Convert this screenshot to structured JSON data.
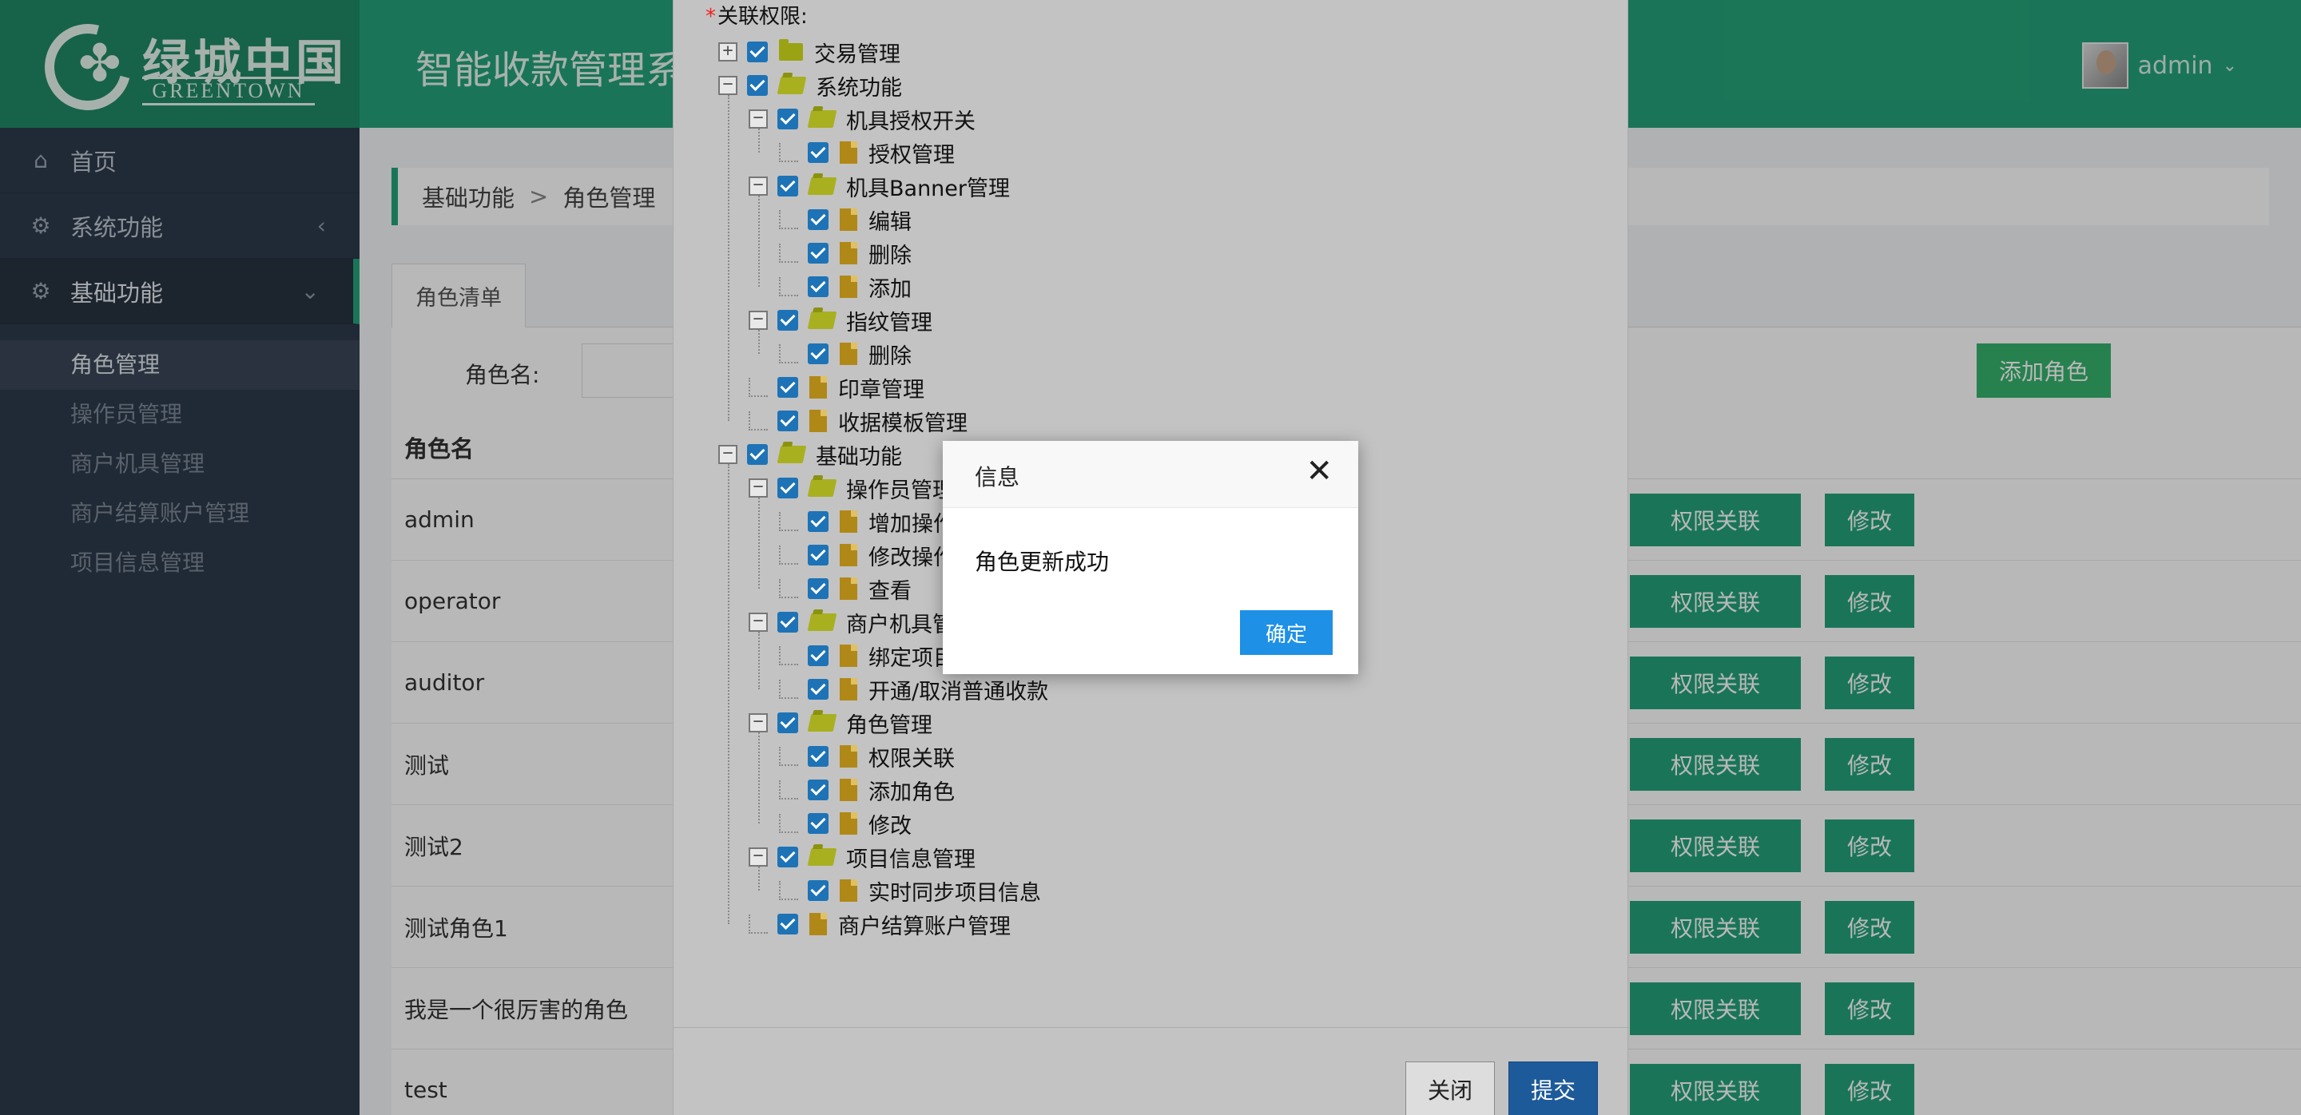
{
  "header": {
    "logo_cn": "绿城中国",
    "logo_en": "GREENTOWN",
    "app_title": "智能收款管理系",
    "user_name": "admin"
  },
  "sidebar": {
    "items": [
      {
        "label": "首页",
        "icon": "home-icon"
      },
      {
        "label": "系统功能",
        "icon": "gears-icon"
      },
      {
        "label": "基础功能",
        "icon": "gears-icon"
      }
    ],
    "sub_items": [
      {
        "label": "角色管理"
      },
      {
        "label": "操作员管理"
      },
      {
        "label": "商户机具管理"
      },
      {
        "label": "商户结算账户管理"
      },
      {
        "label": "项目信息管理"
      }
    ]
  },
  "main": {
    "breadcrumb": {
      "parent": "基础功能",
      "separator": ">",
      "current": "角色管理"
    },
    "tab_label": "角色清单",
    "search_label": "角色名:",
    "add_role_label": "添加角色",
    "table": {
      "header": "角色名",
      "rows": [
        {
          "name": "admin"
        },
        {
          "name": "operator"
        },
        {
          "name": "auditor"
        },
        {
          "name": "测试"
        },
        {
          "name": "测试2"
        },
        {
          "name": "测试角色1"
        },
        {
          "name": "我是一个很厉害的角色"
        },
        {
          "name": "test"
        }
      ],
      "perm_btn_label": "权限关联",
      "edit_btn_label": "修改"
    }
  },
  "perm_layer": {
    "label_required": "*",
    "label": "关联权限:",
    "tree": [
      {
        "depth": 0,
        "toggle": "+",
        "icon": "folder-closed",
        "text": "交易管理"
      },
      {
        "depth": 0,
        "toggle": "−",
        "icon": "folder-open",
        "text": "系统功能"
      },
      {
        "depth": 1,
        "toggle": "−",
        "icon": "folder-open",
        "text": "机具授权开关"
      },
      {
        "depth": 2,
        "toggle": "",
        "icon": "file",
        "text": "授权管理"
      },
      {
        "depth": 1,
        "toggle": "−",
        "icon": "folder-open",
        "text": "机具Banner管理"
      },
      {
        "depth": 2,
        "toggle": "",
        "icon": "file",
        "text": "编辑"
      },
      {
        "depth": 2,
        "toggle": "",
        "icon": "file",
        "text": "删除"
      },
      {
        "depth": 2,
        "toggle": "",
        "icon": "file",
        "text": "添加"
      },
      {
        "depth": 1,
        "toggle": "−",
        "icon": "folder-open",
        "text": "指纹管理"
      },
      {
        "depth": 2,
        "toggle": "",
        "icon": "file",
        "text": "删除"
      },
      {
        "depth": 1,
        "toggle": "",
        "icon": "file",
        "text": "印章管理"
      },
      {
        "depth": 1,
        "toggle": "",
        "icon": "file",
        "text": "收据模板管理"
      },
      {
        "depth": 0,
        "toggle": "−",
        "icon": "folder-open",
        "text": "基础功能"
      },
      {
        "depth": 1,
        "toggle": "−",
        "icon": "folder-open",
        "text": "操作员管理"
      },
      {
        "depth": 2,
        "toggle": "",
        "icon": "file",
        "text": "增加操作"
      },
      {
        "depth": 2,
        "toggle": "",
        "icon": "file",
        "text": "修改操作"
      },
      {
        "depth": 2,
        "toggle": "",
        "icon": "file",
        "text": "查看"
      },
      {
        "depth": 1,
        "toggle": "−",
        "icon": "folder-open",
        "text": "商户机具管"
      },
      {
        "depth": 2,
        "toggle": "",
        "icon": "file",
        "text": "绑定项目"
      },
      {
        "depth": 2,
        "toggle": "",
        "icon": "file",
        "text": "开通/取消普通收款"
      },
      {
        "depth": 1,
        "toggle": "−",
        "icon": "folder-open",
        "text": "角色管理"
      },
      {
        "depth": 2,
        "toggle": "",
        "icon": "file",
        "text": "权限关联"
      },
      {
        "depth": 2,
        "toggle": "",
        "icon": "file",
        "text": "添加角色"
      },
      {
        "depth": 2,
        "toggle": "",
        "icon": "file",
        "text": "修改"
      },
      {
        "depth": 1,
        "toggle": "−",
        "icon": "folder-open",
        "text": "项目信息管理"
      },
      {
        "depth": 2,
        "toggle": "",
        "icon": "file",
        "text": "实时同步项目信息"
      },
      {
        "depth": 1,
        "toggle": "",
        "icon": "file",
        "text": "商户结算账户管理"
      }
    ],
    "close_label": "关闭",
    "submit_label": "提交"
  },
  "info_dialog": {
    "title": "信息",
    "close_glyph": "✕",
    "message": "角色更新成功",
    "ok_label": "确定"
  },
  "colors": {
    "header_green": "#25a37a",
    "sidebar_bg": "#2d3a4b",
    "checkbox_blue": "#1d73b6",
    "ok_blue": "#1e90e6",
    "submit_blue": "#1d5a9a"
  }
}
